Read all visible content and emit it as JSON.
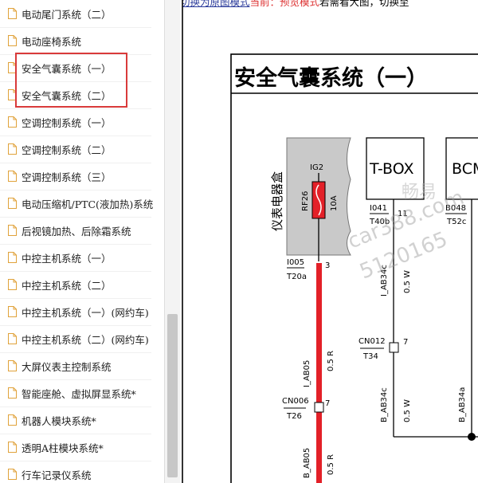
{
  "sidebar": {
    "items": [
      {
        "label": "电动尾门系统（二）"
      },
      {
        "label": "电动座椅系统"
      },
      {
        "label": "安全气囊系统（一）"
      },
      {
        "label": "安全气囊系统（二）"
      },
      {
        "label": "空调控制系统（一）"
      },
      {
        "label": "空调控制系统（二）"
      },
      {
        "label": "空调控制系统（三）"
      },
      {
        "label": "电动压缩机/PTC(液加热)系统"
      },
      {
        "label": "后视镜加热、后除霜系统"
      },
      {
        "label": "中控主机系统（一）"
      },
      {
        "label": "中控主机系统（二）"
      },
      {
        "label": "中控主机系统（一）(网约车)"
      },
      {
        "label": "中控主机系统（二）(网约车)"
      },
      {
        "label": "大屏仪表主控制系统"
      },
      {
        "label": "智能座舱、虚拟屏显系统*"
      },
      {
        "label": "机器人模块系统*"
      },
      {
        "label": "透明A柱模块系统*"
      },
      {
        "label": "行车记录仪系统"
      }
    ],
    "highlight_color": "#d93a3a"
  },
  "header": {
    "link_text": "切换为原图模式",
    "status_text": "当前：预览模式",
    "hint_text": "若需看大图，切换至"
  },
  "diagram": {
    "title": "安全气囊系统（一）",
    "module_label": "仪表电器盒",
    "fuse_top_label": "IG2",
    "fuse_id": "RF26",
    "fuse_rating": "10A",
    "left_connector_pin": "I005",
    "left_connector_id": "T20a",
    "left_pin_number": "3",
    "tbox_label": "T-BOX",
    "tbox_pin": "I041",
    "tbox_connector": "T40b",
    "tbox_pin_number": "11",
    "bcm_label": "BCM",
    "bcm_pin": "B048",
    "bcm_connector": "T52c",
    "wire_1": "I_AB05",
    "wire_1_spec": "0.5 R",
    "wire_2": "I_AB34c",
    "wire_2_spec": "0.5 W",
    "cn012_label": "CN012",
    "cn012_connector": "T34",
    "cn012_pin": "7",
    "cn006_label": "CN006",
    "cn006_connector": "T26",
    "cn006_pin": "7",
    "wire_3": "B_AB34c",
    "wire_3_spec": "0.5 W",
    "wire_4": "B_AB34a",
    "wire_5": "B_AB05",
    "wire_5_spec": "0.5 R",
    "watermark_1": "畅易",
    "watermark_2": "car388.com",
    "watermark_3": "5120165",
    "wire_color_red": "#e32028",
    "module_fill": "#c9c9c9"
  }
}
